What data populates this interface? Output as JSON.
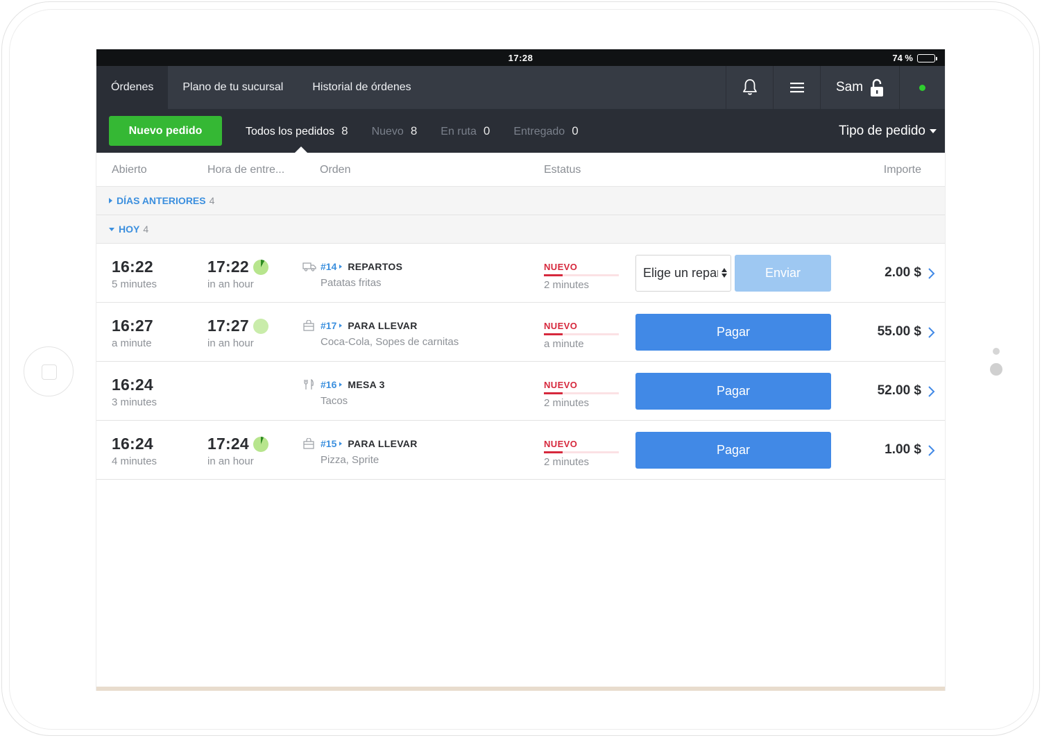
{
  "status_bar": {
    "time": "17:28",
    "battery": "74 %",
    "battery_level": 0.74
  },
  "nav": {
    "tabs": [
      {
        "label": "Órdenes",
        "active": true
      },
      {
        "label": "Plano de tu sucursal",
        "active": false
      },
      {
        "label": "Historial de órdenes",
        "active": false
      }
    ],
    "icons": {
      "notifications": "bell-icon",
      "menu": "hamburger-menu-icon",
      "lock": "unlock-icon"
    },
    "user": "Sam",
    "online_color": "#2fce2f"
  },
  "filters": {
    "new_order_label": "Nuevo pedido",
    "items": [
      {
        "label": "Todos los pedidos",
        "count": "8",
        "active": true
      },
      {
        "label": "Nuevo",
        "count": "8",
        "active": false
      },
      {
        "label": "En ruta",
        "count": "0",
        "active": false
      },
      {
        "label": "Entregado",
        "count": "0",
        "active": false
      }
    ],
    "type_label": "Tipo de pedido"
  },
  "columns": {
    "open": "Abierto",
    "delivery": "Hora de entre...",
    "order": "Orden",
    "status": "Estatus",
    "amount": "Importe"
  },
  "groups": {
    "previous": {
      "label": "DÍAS ANTERIORES",
      "count": "4"
    },
    "today": {
      "label": "HOY",
      "count": "4"
    }
  },
  "orders": [
    {
      "open_time": "16:22",
      "open_ago": "5 minutes",
      "delivery_time": "17:22",
      "delivery_in": "in an hour",
      "delivery_progress": 0.08,
      "icon": "delivery-truck-icon",
      "number": "#14",
      "type": "REPARTOS",
      "items": "Patatas fritas",
      "status": "NUEVO",
      "status_ago": "2 minutes",
      "status_progress": 0.25,
      "rider_placeholder": "Elige un repartidor",
      "action_label": "Enviar",
      "amount": "2.00 $"
    },
    {
      "open_time": "16:27",
      "open_ago": "a minute",
      "delivery_time": "17:27",
      "delivery_in": "in an hour",
      "delivery_progress": 0.0,
      "icon": "takeaway-bag-icon",
      "number": "#17",
      "type": "PARA LLEVAR",
      "items": "Coca-Cola, Sopes de carnitas",
      "status": "NUEVO",
      "status_ago": "a minute",
      "status_progress": 0.25,
      "action_label": "Pagar",
      "amount": "55.00 $"
    },
    {
      "open_time": "16:24",
      "open_ago": "3 minutes",
      "delivery_time": "",
      "delivery_in": "",
      "icon": "fork-knife-icon",
      "number": "#16",
      "type": "MESA 3",
      "items": "Tacos",
      "status": "NUEVO",
      "status_ago": "2 minutes",
      "status_progress": 0.25,
      "action_label": "Pagar",
      "amount": "52.00 $"
    },
    {
      "open_time": "16:24",
      "open_ago": "4 minutes",
      "delivery_time": "17:24",
      "delivery_in": "in an hour",
      "delivery_progress": 0.06,
      "icon": "takeaway-bag-icon",
      "number": "#15",
      "type": "PARA LLEVAR",
      "items": "Pizza, Sprite",
      "status": "NUEVO",
      "status_ago": "2 minutes",
      "status_progress": 0.25,
      "action_label": "Pagar",
      "amount": "1.00 $"
    }
  ],
  "colors": {
    "primary": "#4189e6",
    "success": "#35b834",
    "danger": "#d6293d",
    "link": "#3b8fde"
  }
}
